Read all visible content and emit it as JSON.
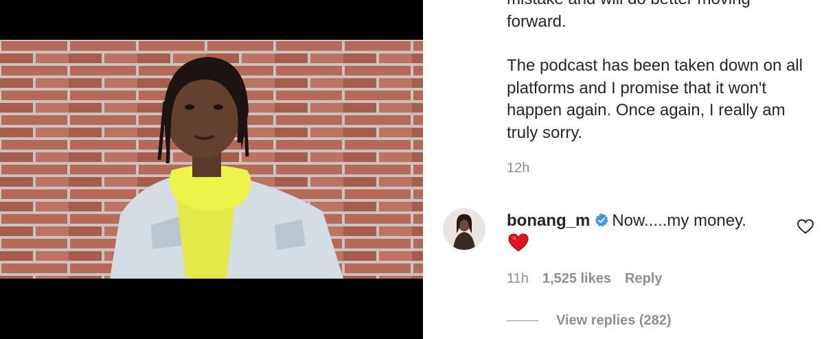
{
  "post": {
    "caption_top": "mistake and will do better moving forward.",
    "caption_paragraph": "The podcast has been taken down on all platforms and I promise that it won't happen again. Once again, I really am truly sorry.",
    "time": "12h"
  },
  "comment": {
    "username": "bonang_m",
    "verified_icon": "verified-badge-icon",
    "text": "Now.....my money.",
    "emoji": "red-heart-emoji",
    "time": "11h",
    "likes": "1,525 likes",
    "reply_label": "Reply",
    "view_replies": "View replies (282)"
  },
  "colors": {
    "text": "#262626",
    "secondary": "#8e8e8e",
    "verified": "#3897f0",
    "heart": "#ed1c24"
  }
}
